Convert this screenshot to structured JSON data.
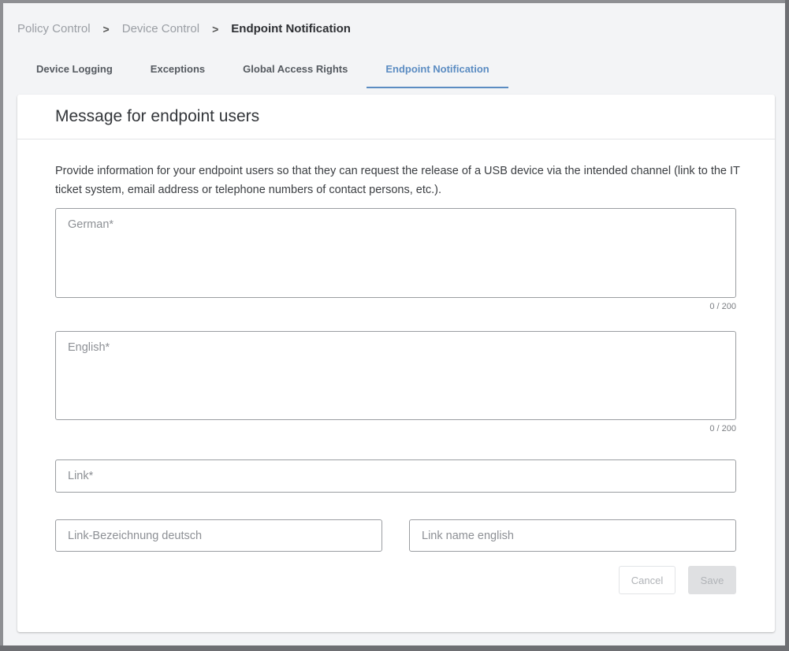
{
  "breadcrumb": {
    "items": [
      "Policy Control",
      "Device Control"
    ],
    "current": "Endpoint Notification",
    "separator": ">"
  },
  "tabs": [
    {
      "label": "Device Logging",
      "active": false
    },
    {
      "label": "Exceptions",
      "active": false
    },
    {
      "label": "Global Access Rights",
      "active": false
    },
    {
      "label": "Endpoint Notification",
      "active": true
    }
  ],
  "card": {
    "title": "Message for endpoint users",
    "description": "Provide information for your endpoint users so that they can request the release of a USB device via the intended channel (link to the IT ticket system, email address or telephone numbers of contact persons, etc.).",
    "fields": {
      "german": {
        "placeholder": "German*",
        "value": "",
        "counter": "0 / 200"
      },
      "english": {
        "placeholder": "English*",
        "value": "",
        "counter": "0 / 200"
      },
      "link": {
        "placeholder": "Link*",
        "value": ""
      },
      "link_name_de": {
        "placeholder": "Link-Bezeichnung deutsch",
        "value": ""
      },
      "link_name_en": {
        "placeholder": "Link name english",
        "value": ""
      }
    },
    "buttons": {
      "cancel": "Cancel",
      "save": "Save"
    }
  },
  "colors": {
    "accent": "#5b8cc2",
    "background": "#f3f4f6",
    "disabled_button": "#dfe0e2"
  }
}
